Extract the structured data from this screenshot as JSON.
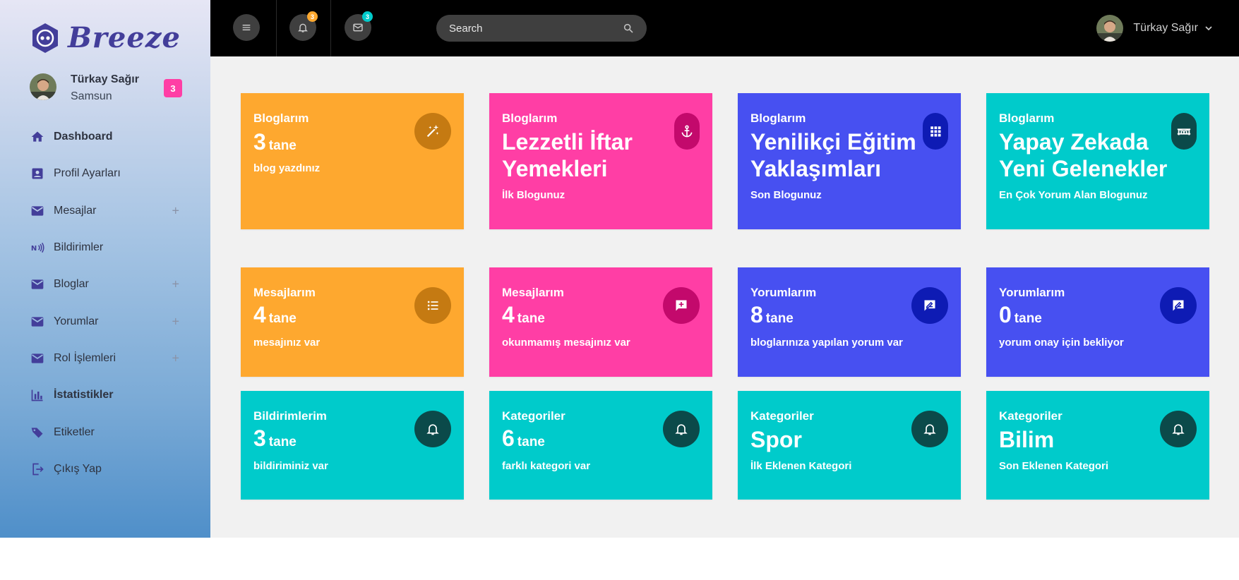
{
  "brand": {
    "name": "Breeze"
  },
  "profile": {
    "name": "Türkay Sağır",
    "city": "Samsun",
    "badge": "3"
  },
  "nav": [
    {
      "label": "Dashboard",
      "icon": "home-icon",
      "expandable": false
    },
    {
      "label": "Profil Ayarları",
      "icon": "profile-icon",
      "expandable": false
    },
    {
      "label": "Mesajlar",
      "icon": "mail-icon",
      "expandable": true
    },
    {
      "label": "Bildirimler",
      "icon": "nfc-icon",
      "expandable": false
    },
    {
      "label": "Bloglar",
      "icon": "mail-icon",
      "expandable": true
    },
    {
      "label": "Yorumlar",
      "icon": "mail-icon",
      "expandable": true
    },
    {
      "label": "Rol İşlemleri",
      "icon": "mail-icon",
      "expandable": true
    },
    {
      "label": "İstatistikler",
      "icon": "chart-icon",
      "expandable": false
    },
    {
      "label": "Etiketler",
      "icon": "tags-icon",
      "expandable": false
    },
    {
      "label": "Çıkış Yap",
      "icon": "logout-icon",
      "expandable": false
    }
  ],
  "nav_plus": "+",
  "topbar": {
    "notifications_count": "3",
    "messages_count": "3",
    "search_placeholder": "Search",
    "user_name": "Türkay Sağır"
  },
  "cards_row1": [
    {
      "label": "Bloglarım",
      "value": "3",
      "unit": "tane",
      "sub": "blog yazdınız",
      "color": "#fea82f",
      "icon": "magic-wand-icon"
    },
    {
      "label": "Bloglarım",
      "title": "Lezzetli İftar Yemekleri",
      "sub": "İlk Blogunuz",
      "color": "#ff3ea5",
      "icon": "anchor-icon"
    },
    {
      "label": "Bloglarım",
      "title": "Yenilikçi Eğitim Yaklaşımları",
      "sub": "Son Blogunuz",
      "color": "#4750f1",
      "icon": "grid-icon"
    },
    {
      "label": "Bloglarım",
      "title": "Yapay Zekada Yeni Gelenekler",
      "sub": "En Çok Yorum Alan Blogunuz",
      "color": "#00cbcb",
      "icon": "bridge-icon"
    }
  ],
  "cards_row2": [
    {
      "label": "Mesajlarım",
      "value": "4",
      "unit": "tane",
      "sub": "mesajınız var",
      "color": "#fea82f",
      "icon": "list-icon"
    },
    {
      "label": "Mesajlarım",
      "value": "4",
      "unit": "tane",
      "sub": "okunmamış mesajınız var",
      "color": "#ff3ea5",
      "icon": "add-comment-icon"
    },
    {
      "label": "Yorumlarım",
      "value": "8",
      "unit": "tane",
      "sub": "bloglarınıza yapılan yorum var",
      "color": "#4750f1",
      "icon": "rate-review-icon"
    },
    {
      "label": "Yorumlarım",
      "value": "0",
      "unit": "tane",
      "sub": "yorum onay için bekliyor",
      "color": "#4750f1",
      "icon": "rate-review-icon"
    }
  ],
  "cards_row3": [
    {
      "label": "Bildirimlerim",
      "value": "3",
      "unit": "tane",
      "sub": "bildiriminiz var",
      "color": "#00cbcb",
      "icon": "bell-icon"
    },
    {
      "label": "Kategoriler",
      "value": "6",
      "unit": "tane",
      "sub": "farklı kategori var",
      "color": "#00cbcb",
      "icon": "bell-icon"
    },
    {
      "label": "Kategoriler",
      "title": "Spor",
      "sub": "İlk Eklenen Kategori",
      "color": "#00cbcb",
      "icon": "bell-icon"
    },
    {
      "label": "Kategoriler",
      "title": "Bilim",
      "sub": "Son Eklenen Kategori",
      "color": "#00cbcb",
      "icon": "bell-icon"
    }
  ]
}
